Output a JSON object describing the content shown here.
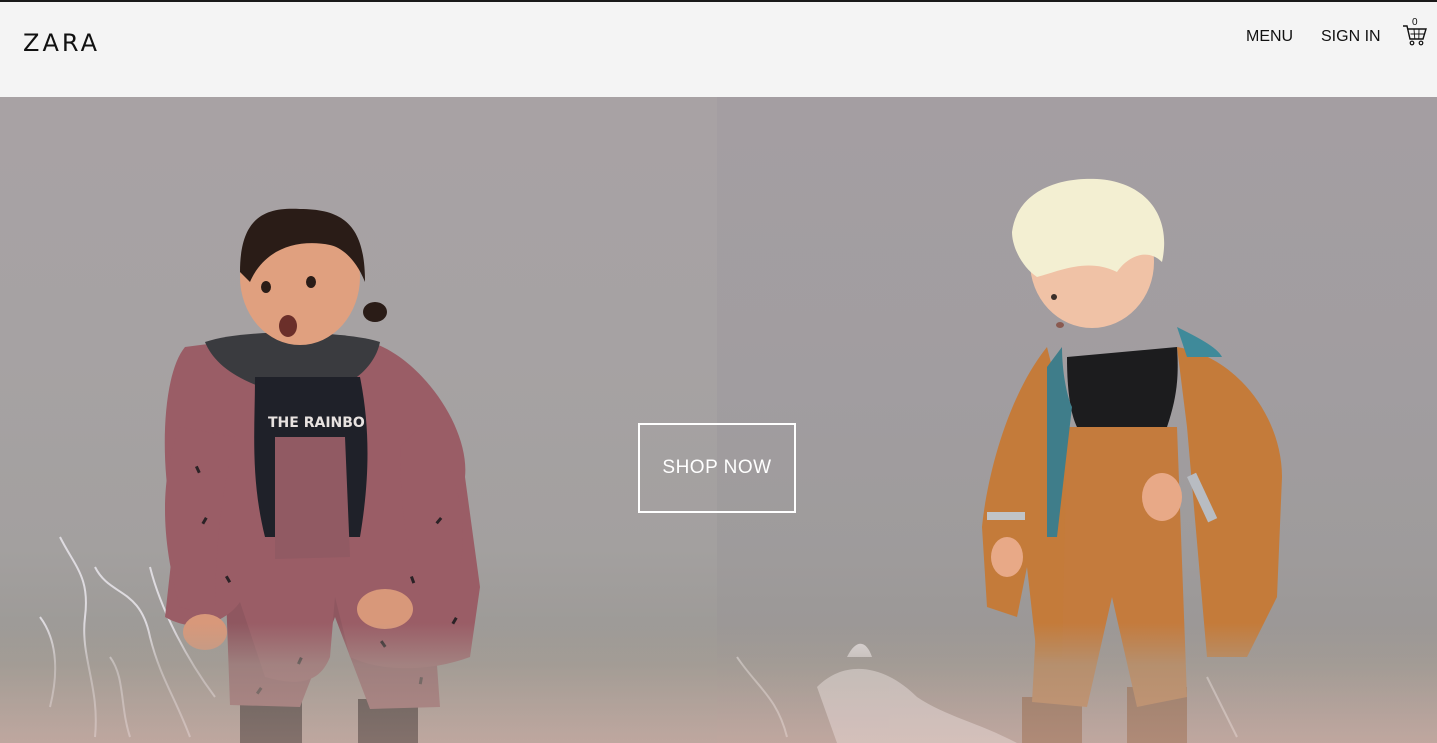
{
  "header": {
    "logo_text": "ZARA",
    "menu_label": "MENU",
    "signin_label": "SIGN IN",
    "cart_count": "0",
    "cart_icon": "shopping-cart-icon"
  },
  "hero": {
    "cta_label": "SHOP NOW",
    "left_image": "child-in-pink-raincoat-splashing",
    "right_image": "child-in-orange-raincoat-splashing"
  },
  "colors": {
    "header_bg": "#f4f4f4",
    "text": "#111111",
    "cta_border": "#ffffff"
  }
}
